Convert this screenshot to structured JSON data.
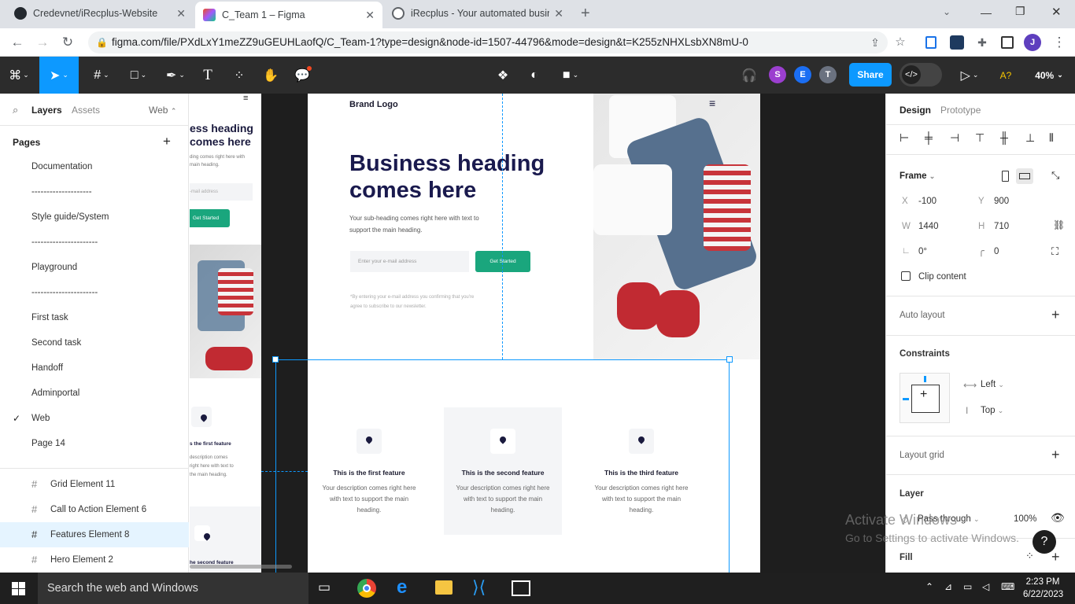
{
  "browser": {
    "tabs": [
      {
        "title": "Credevnet/iRecplus-Website",
        "active": false
      },
      {
        "title": "C_Team 1 – Figma",
        "active": true
      },
      {
        "title": "iRecplus - Your automated busin",
        "active": false
      }
    ],
    "new_tab": "+",
    "url": "figma.com/file/PXdLxY1meZZ9uGEUHLaofQ/C_Team-1?type=design&node-id=1507-44796&mode=design&t=K255zNHXLsbXN8mU-0",
    "profile_initial": "J"
  },
  "toolbar": {
    "avatars": [
      {
        "letter": "S",
        "color": "#9b3fcf"
      },
      {
        "letter": "E",
        "color": "#1b6ef3"
      },
      {
        "letter": "T",
        "color": "#6b7280"
      }
    ],
    "share_label": "Share",
    "zoom": "40%",
    "ai_label": "A?"
  },
  "left_panel": {
    "tabs": {
      "layers": "Layers",
      "assets": "Assets",
      "page_switch": "Web"
    },
    "pages_title": "Pages",
    "pages": [
      "Documentation",
      "--------------------",
      "Style guide/System",
      "----------------------",
      "Playground",
      "----------------------",
      "First task",
      "Second task",
      "Handoff",
      "Adminportal",
      "Web",
      "Page 14"
    ],
    "current_page": "Web",
    "layers": [
      "Grid Element 11",
      "Call to Action Element 6",
      "Features Element 8",
      "Hero Element 2"
    ],
    "selected_layer": "Features Element 8"
  },
  "canvas": {
    "side_frame": {
      "heading": "ess heading\ncomes here",
      "desc": "ding comes right here with\nmain heading.",
      "input": "-mail address",
      "button": "Get Started",
      "feature1": "s the first feature",
      "feature1_desc": "description comes\nright here with text to\nthe main heading.",
      "feature2": "he second feature"
    },
    "hero": {
      "brand": "Brand Logo",
      "heading": "Business heading\ncomes here",
      "subheading": "Your sub-heading comes right here with text to\nsupport the main heading.",
      "input_placeholder": "Enter your e-mail address",
      "button": "Get Started",
      "disclaimer": "*By entering your e-mail address you confirming that you're\nagree to subscribe to our newsletter."
    },
    "features": [
      {
        "title": "This is the first feature",
        "desc": "Your description comes right here with text to support the main heading."
      },
      {
        "title": "This is the second feature",
        "desc": "Your description comes right here with text to support the main heading."
      },
      {
        "title": "This is the third feature",
        "desc": "Your description comes right here with text to support the main heading."
      }
    ]
  },
  "right_panel": {
    "tabs": {
      "design": "Design",
      "prototype": "Prototype"
    },
    "frame_label": "Frame",
    "x_label": "X",
    "x": "-100",
    "y_label": "Y",
    "y": "900",
    "w_label": "W",
    "w": "1440",
    "h_label": "H",
    "h": "710",
    "rotation": "0°",
    "radius": "0",
    "clip_content": "Clip content",
    "auto_layout": "Auto layout",
    "constraints": "Constraints",
    "constraint_h": "Left",
    "constraint_v": "Top",
    "layout_grid": "Layout grid",
    "layer": "Layer",
    "blend": "Pass through",
    "opacity": "100%",
    "fill": "Fill",
    "watermark_title": "Activate Windows",
    "watermark_sub": "Go to Settings to activate Windows.",
    "help": "?"
  },
  "taskbar": {
    "search": "Search the web and Windows",
    "time": "2:23 PM",
    "date": "6/22/2023"
  },
  "colors": {
    "figma_toolbar": "#2c2c2c",
    "share_blue": "#0d99ff",
    "accent_green": "#1aa67d",
    "selection_blue": "#0d99ff"
  }
}
